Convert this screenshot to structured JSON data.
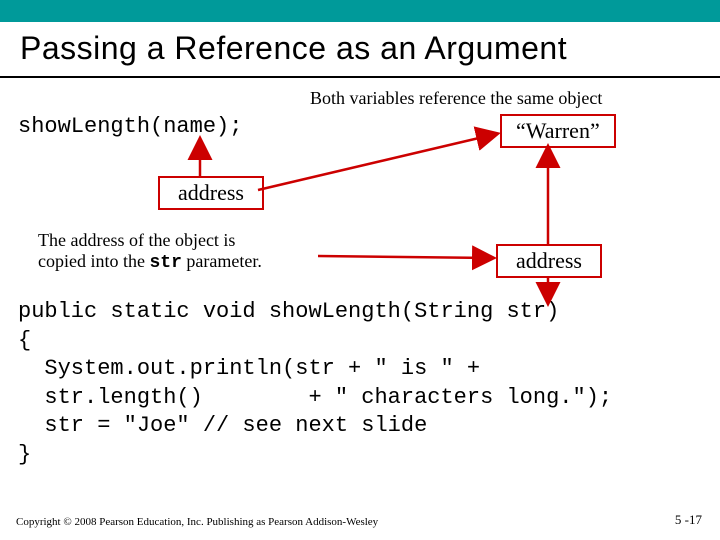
{
  "title": "Passing a Reference as an Argument",
  "both_variables": "Both variables reference the same object",
  "call_line": "showLength(name);",
  "warren": "“Warren”",
  "address_label_1": "address",
  "address_label_2": "address",
  "addr_explain_1": "The address of the object is",
  "addr_explain_2": "copied into the ",
  "addr_explain_str": "str",
  "addr_explain_3": " parameter.",
  "code": {
    "sig": "public static void showLength(String str)",
    "open": "{",
    "l1": "  System.out.println(str + \" is \" +",
    "l2": "  str.length()        + \" characters long.\");",
    "l3": "  str = \"Joe\" // see next slide",
    "close": "}"
  },
  "copyright": "Copyright © 2008 Pearson Education, Inc. Publishing as Pearson Addison-Wesley",
  "slidenum": "5 -17"
}
